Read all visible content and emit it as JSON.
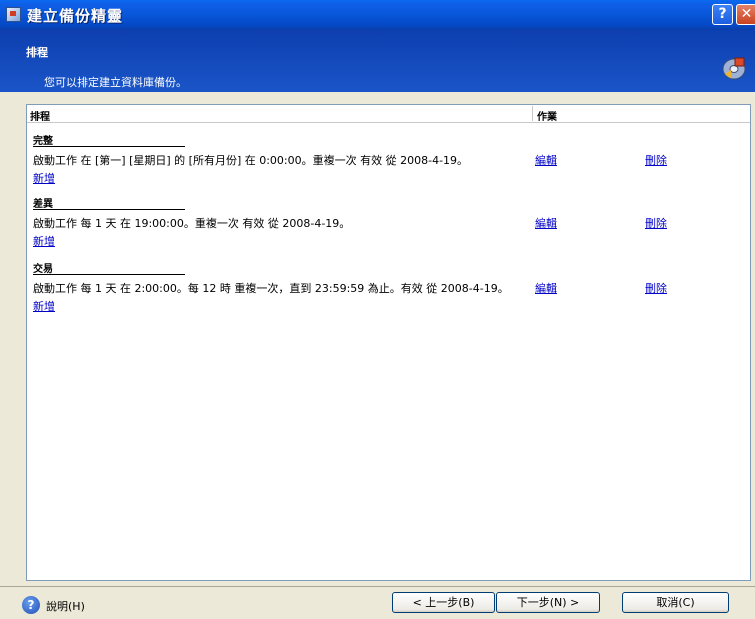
{
  "window": {
    "title": "建立備份精靈",
    "help_button": "?",
    "close_button": "✕"
  },
  "header": {
    "title": "排程",
    "subtitle": "您可以排定建立資料庫備份。"
  },
  "table": {
    "col_schedule": "排程",
    "col_action": "作業",
    "groups": [
      {
        "name": "完整",
        "description": "啟動工作 在 [第一] [星期日] 的 [所有月份] 在 0:00:00。重複一次 有效 從 2008-4-19。",
        "add": "新增",
        "edit": "編輯",
        "delete": "刪除"
      },
      {
        "name": "差異",
        "description": "啟動工作 每 1 天 在 19:00:00。重複一次 有效 從 2008-4-19。",
        "add": "新增",
        "edit": "編輯",
        "delete": "刪除"
      },
      {
        "name": "交易",
        "description": "啟動工作 每 1 天 在 2:00:00。每 12 時 重複一次，直到 23:59:59 為止。有效 從 2008-4-19。",
        "add": "新增",
        "edit": "編輯",
        "delete": "刪除"
      }
    ]
  },
  "footer": {
    "help_label": "說明(H)",
    "back_button": "< 上一步(B)",
    "next_button": "下一步(N) >",
    "cancel_button": "取消(C)"
  }
}
